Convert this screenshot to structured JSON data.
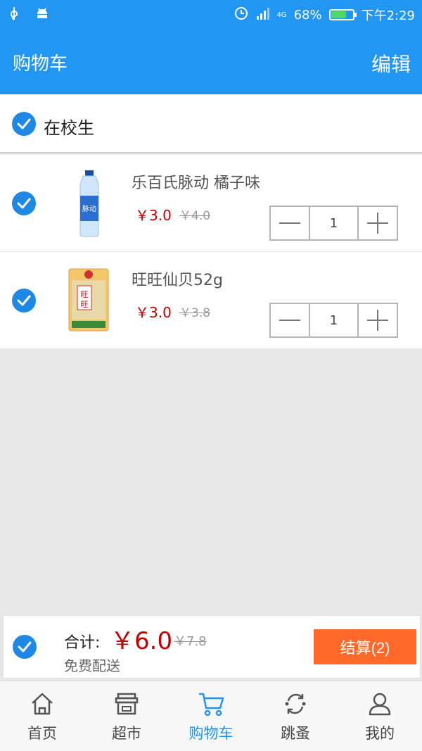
{
  "statusbar": {
    "battery": "68%",
    "time": "下午2:29",
    "signal_label": "4G"
  },
  "header": {
    "title": "购物车",
    "edit_label": "编辑"
  },
  "store": {
    "name": "在校生"
  },
  "items": [
    {
      "name": "乐百氏脉动 橘子味",
      "price": "￥3.0",
      "original_price": "￥4.0",
      "quantity": "1"
    },
    {
      "name": "旺旺仙贝52g",
      "price": "￥3.0",
      "original_price": "￥3.8",
      "quantity": "1"
    }
  ],
  "summary": {
    "total_label": "合计:",
    "total_price": "￥6.0",
    "original_total": "￥7.8",
    "delivery": "免费配送",
    "checkout_label": "结算(2)"
  },
  "nav": {
    "items": [
      {
        "label": "首页",
        "icon": "home-icon"
      },
      {
        "label": "超市",
        "icon": "store-icon"
      },
      {
        "label": "购物车",
        "icon": "cart-icon"
      },
      {
        "label": "跳蚤",
        "icon": "exchange-icon"
      },
      {
        "label": "我的",
        "icon": "user-icon"
      }
    ],
    "active": "购物车"
  },
  "colors": {
    "primary": "#2196f3",
    "price": "#c40000",
    "checkout": "#ff6a2b",
    "check": "#1e88e5"
  }
}
